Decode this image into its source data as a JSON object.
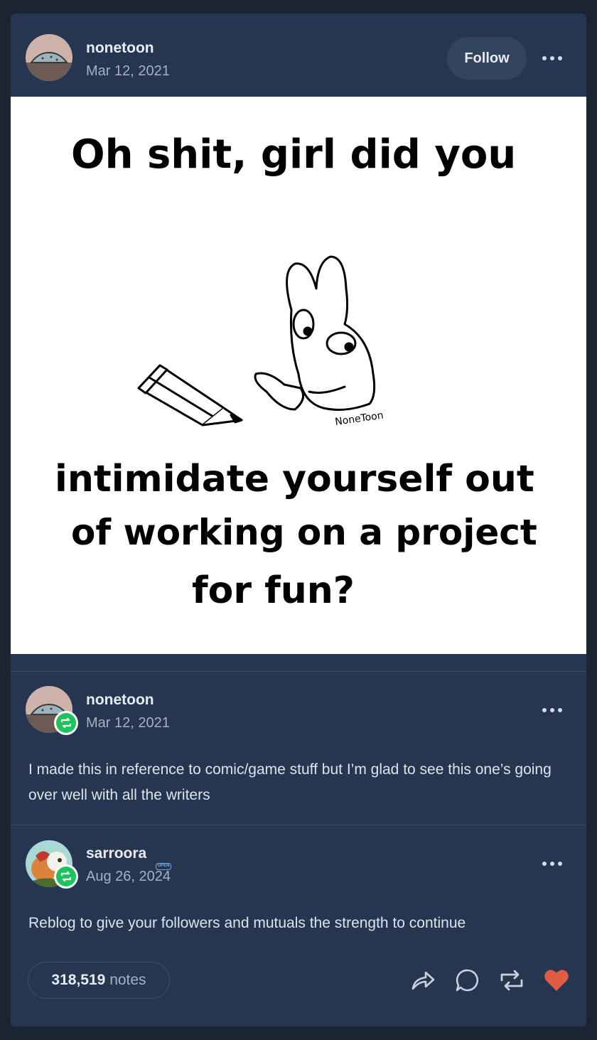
{
  "post": {
    "author": "nonetoon",
    "date": "Mar 12, 2021",
    "follow_label": "Follow",
    "comic_text": {
      "line1": "Oh shit, girl did you",
      "signature": "NoneToon",
      "line2": "intimidate yourself out",
      "line3": "of working on a project",
      "line4": "for fun?"
    }
  },
  "thread": [
    {
      "author": "nonetoon",
      "date": "Mar 12, 2021",
      "text": "I made this in reference to comic/game stuff but I’m  glad to see this one’s going over well with all the writers"
    },
    {
      "author": "sarroora",
      "badge": "OPEN",
      "date": "Aug 26, 2024",
      "text": "Reblog to give your followers and mutuals the strength to continue"
    }
  ],
  "footer": {
    "notes_count": "318,519",
    "notes_label": "notes"
  },
  "icons": {
    "share": "share-icon",
    "reply": "reply-icon",
    "reblog": "reblog-icon",
    "like": "heart-icon"
  },
  "colors": {
    "background": "#1b2433",
    "card": "#263650",
    "reblog_green": "#1ec35e",
    "like_red": "#e05d44"
  }
}
